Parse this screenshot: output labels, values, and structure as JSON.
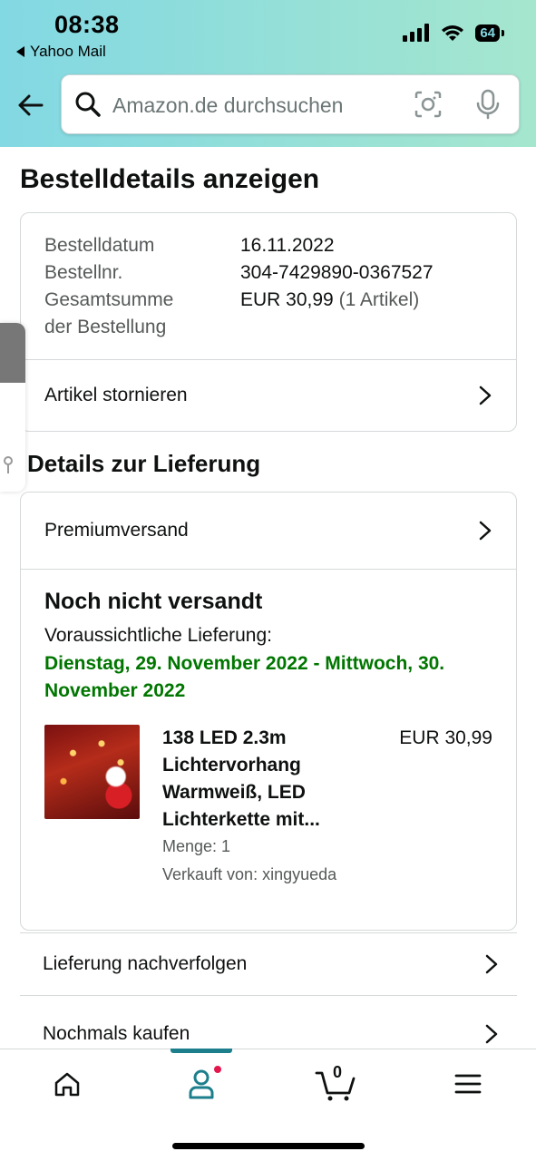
{
  "status_bar": {
    "time": "08:38",
    "back_app": "Yahoo Mail",
    "battery": "64"
  },
  "search": {
    "placeholder": "Amazon.de durchsuchen"
  },
  "page_title": "Bestelldetails anzeigen",
  "order": {
    "date_label": "Bestelldatum",
    "date_value": "16.11.2022",
    "number_label": "Bestellnr.",
    "number_value": "304-7429890-0367527",
    "total_label_line1": "Gesamtsumme",
    "total_label_line2": "der Bestellung",
    "total_value": "EUR 30,99",
    "total_items": "(1 Artikel)",
    "cancel_label": "Artikel stornieren"
  },
  "delivery": {
    "section_title": "Details zur Lieferung",
    "shipping_method": "Premiumversand",
    "status": "Noch nicht versandt",
    "expected_label": "Voraussichtliche Lieferung:",
    "expected_dates": "Dienstag, 29. November 2022 - Mittwoch, 30. November 2022",
    "item": {
      "title": "138 LED 2.3m Lichtervorhang Warmweiß, LED Lichterkette mit...",
      "price": "EUR 30,99",
      "quantity": "Menge: 1",
      "seller": "Verkauft von: xingyueda"
    }
  },
  "actions": {
    "track": "Lieferung nachverfolgen",
    "buy_again": "Nochmals kaufen"
  },
  "bottom_nav": {
    "cart_count": "0",
    "active": "account"
  },
  "colors": {
    "header_gradient_start": "#82d8e3",
    "header_gradient_end": "#a5e6ce",
    "delivery_green": "#007600",
    "nav_accent": "#1d7f8c",
    "notification_dot": "#e3174e"
  }
}
